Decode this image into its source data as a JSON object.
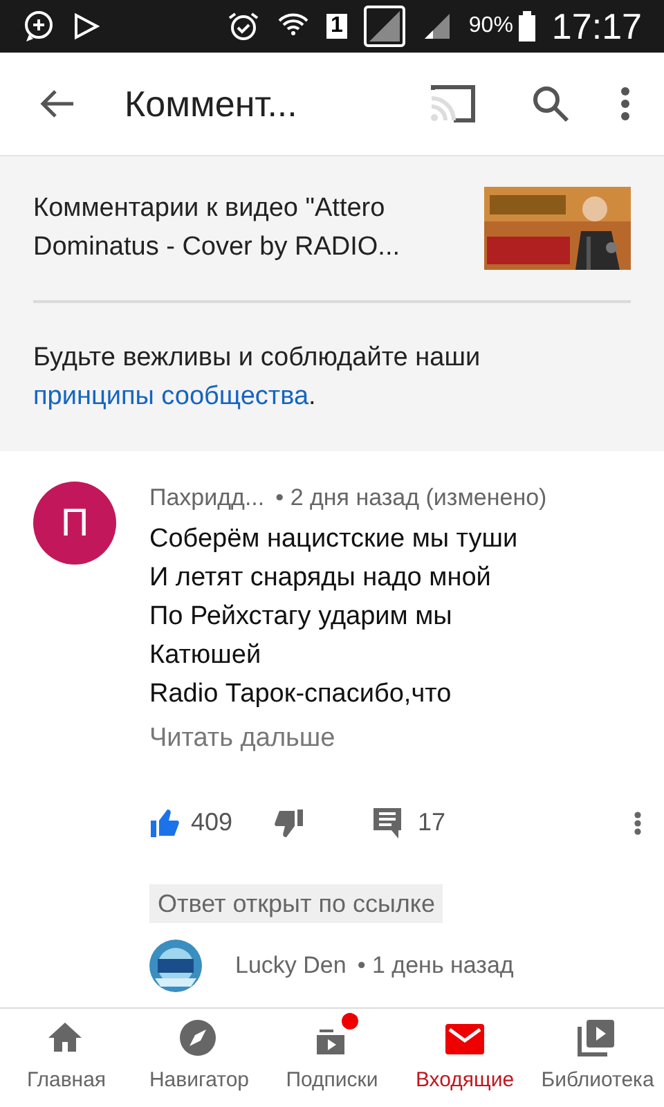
{
  "status_bar": {
    "sim": "1",
    "battery": "90%",
    "time": "17:17"
  },
  "app_bar": {
    "title": "Коммент..."
  },
  "video": {
    "title": "Комментарии к видео \"Attero Dominatus - Cover by RADIO..."
  },
  "guidelines": {
    "text": "Будьте вежливы и соблюдайте наши",
    "link": "принципы сообщества",
    "end": "."
  },
  "comment": {
    "avatar_letter": "П",
    "author": "Пахридд...",
    "meta": "• 2 дня назад (изменено)",
    "lines": [
      "Соберём нацистские мы туши",
      "И летят снаряды надо мной",
      "По Рейхстагу ударим мы",
      "Катюшей",
      "Radio Тарок-спасибо,что"
    ],
    "read_more": "Читать дальше",
    "likes": "409",
    "liked": true,
    "replies": "17"
  },
  "reply": {
    "chip": "Ответ открыт по ссылке",
    "author": "Lucky Den",
    "meta": "• 1 день назад"
  },
  "nav": [
    {
      "label": "Главная",
      "kind": "home",
      "selected": false,
      "badge": false
    },
    {
      "label": "Навигатор",
      "kind": "explore",
      "selected": false,
      "badge": false
    },
    {
      "label": "Подписки",
      "kind": "subs",
      "selected": false,
      "badge": true
    },
    {
      "label": "Входящие",
      "kind": "inbox",
      "selected": true,
      "badge": false
    },
    {
      "label": "Библиотека",
      "kind": "library",
      "selected": false,
      "badge": false
    }
  ]
}
